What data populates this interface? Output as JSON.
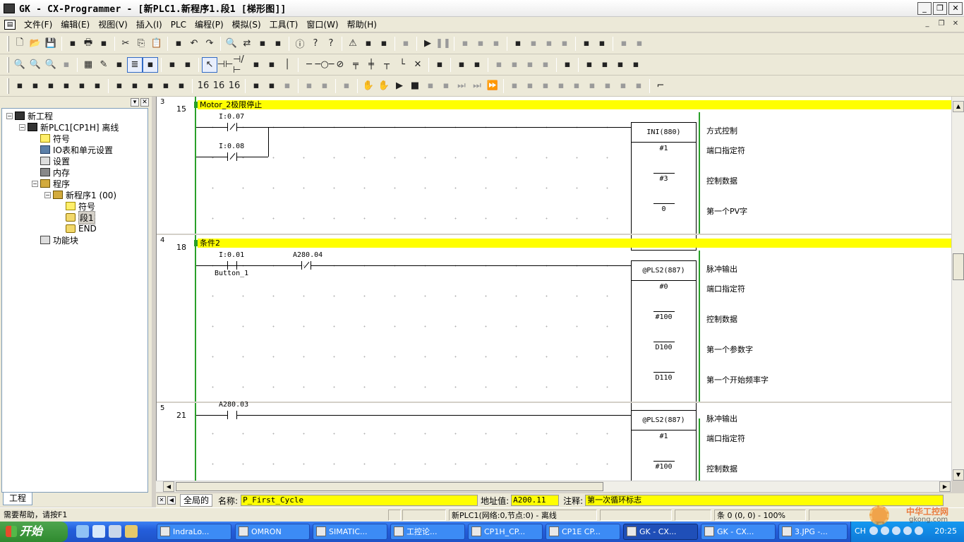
{
  "window": {
    "title": "GK - CX-Programmer - [新PLC1.新程序1.段1 [梯形图]]",
    "buttons": [
      "_",
      "❐",
      "✕"
    ]
  },
  "menu": {
    "items": [
      "文件(F)",
      "编辑(E)",
      "视图(V)",
      "插入(I)",
      "PLC",
      "编程(P)",
      "模拟(S)",
      "工具(T)",
      "窗口(W)",
      "帮助(H)"
    ],
    "mdi_buttons": [
      "_",
      "❐",
      "✕"
    ]
  },
  "toolbars": {
    "row1": [
      "new-icon",
      "open-icon",
      "save-icon",
      "sep",
      "print-preview-icon",
      "print-icon",
      "print-preview2-icon",
      "sep",
      "cut-icon",
      "copy-icon",
      "paste-icon",
      "sep",
      "paste-special-icon",
      "undo-icon",
      "redo-icon",
      "sep",
      "find-icon",
      "replace-icon",
      "replace-all-icon",
      "address-ref-icon",
      "sep",
      "properties-icon",
      "help-icon",
      "context-help-icon",
      "sep",
      "warning-icon",
      "compile-icon",
      "compile-all-icon",
      "sep",
      "online-toggle-icon",
      "sep",
      "play-icon",
      "pause-icon",
      "sep",
      "transfer-to-plc-icon",
      "transfer-from-plc-icon",
      "compare-icon",
      "sep",
      "monitor-icon",
      "monitor2-icon",
      "monitor3-icon",
      "monitor4-icon",
      "sep",
      "data-trace-icon",
      "time-chart-icon",
      "sep",
      "force-on-icon",
      "force-off-icon"
    ],
    "row2": [
      "zoom-out-small-icon",
      "zoom-in-icon",
      "zoom-icon",
      "zoom-disabled-icon",
      "sep",
      "grid-icon",
      "comment-icon",
      "show-list-icon",
      "rung-icon",
      "show-address-icon",
      "sep",
      "monitor-bin-icon",
      "cross-reference-icon",
      "sep",
      "select-cursor-icon",
      "no-contact-icon",
      "nc-contact-icon",
      "no-or-icon",
      "nc-or-icon",
      "vertical-line-icon",
      "sep",
      "horizontal-line-icon",
      "coil-icon",
      "nc-coil-icon",
      "instruction-icon",
      "fb-icon",
      "line-connect-icon",
      "line-corner-icon",
      "delete-line-icon",
      "sep",
      "online-edit-icon",
      "sep",
      "edit-rungs-icon",
      "data-edit-icon",
      "sep",
      "diff-icon",
      "diff2-icon",
      "diff3-icon",
      "diff4-icon",
      "sep",
      "io-comments-icon",
      "sep",
      "disp-icon",
      "disp2-icon",
      "disp3-icon",
      "disp4-icon"
    ],
    "row3": [
      "window-project-icon",
      "window-output-icon",
      "window-watch-icon",
      "window-address-icon",
      "window-symbol-icon",
      "window-properties-icon",
      "sep",
      "cross-ref-icon",
      "symbol-table-icon",
      "program-icon",
      "io-table-icon",
      "settings-icon",
      "sep",
      "binary-16-icon",
      "binary-16b-icon",
      "binary-16c-icon",
      "sep",
      "upload-icon",
      "download-icon",
      "step-icon",
      "sep",
      "plc-list-icon",
      "plc-cycle-icon",
      "sep",
      "plc-info-icon",
      "sep",
      "hand-icon",
      "hand2-icon",
      "run-icon",
      "stop-icon",
      "pause-step-icon",
      "step-run-icon",
      "step-into-icon",
      "step-over-icon",
      "fast-forward-icon",
      "sep",
      "io-map-icon",
      "io-map2-icon",
      "sim1-icon",
      "sim2-icon",
      "sim3-icon",
      "sim4-icon",
      "sim5-icon",
      "sim6-icon",
      "sim7-icon",
      "sep",
      "end-icon"
    ]
  },
  "project_tree": {
    "header_buttons": [
      "▾",
      "✕"
    ],
    "nodes": [
      {
        "label": "新工程",
        "level": 0,
        "expander": "−",
        "icon": "project-icon",
        "type": "plc"
      },
      {
        "label": "新PLC1[CP1H] 离线",
        "level": 1,
        "expander": "−",
        "icon": "plc-icon",
        "type": "plc"
      },
      {
        "label": "符号",
        "level": 2,
        "expander": "",
        "icon": "symbols-icon",
        "type": "sym"
      },
      {
        "label": "IO表和单元设置",
        "level": 2,
        "expander": "",
        "icon": "io-table-icon",
        "type": "ic"
      },
      {
        "label": "设置",
        "level": 2,
        "expander": "",
        "icon": "settings-icon",
        "type": "fb"
      },
      {
        "label": "内存",
        "level": 2,
        "expander": "",
        "icon": "memory-icon",
        "type": "mem"
      },
      {
        "label": "程序",
        "level": 2,
        "expander": "−",
        "icon": "programs-icon",
        "type": "prog"
      },
      {
        "label": "新程序1 (00)",
        "level": 3,
        "expander": "−",
        "icon": "program-icon",
        "type": "prog"
      },
      {
        "label": "符号",
        "level": 4,
        "expander": "",
        "icon": "local-symbols-icon",
        "type": "sym"
      },
      {
        "label": "段1",
        "level": 4,
        "expander": "",
        "icon": "section-icon",
        "type": "sec",
        "selected": true
      },
      {
        "label": "END",
        "level": 4,
        "expander": "",
        "icon": "end-section-icon",
        "type": "sec"
      },
      {
        "label": "功能块",
        "level": 2,
        "expander": "",
        "icon": "function-block-icon",
        "type": "fb"
      }
    ],
    "tab_label": "工程"
  },
  "ladder": {
    "rungs": [
      {
        "rung": "3",
        "step": "15",
        "comment": "Motor_2极限停止",
        "contacts": [
          {
            "address": "I:0.07",
            "type": "nc",
            "symbol": ""
          },
          {
            "address": "I:0.08",
            "type": "nc",
            "symbol": ""
          }
        ],
        "instruction": "INI(880)",
        "operands": [
          {
            "value": "#1",
            "desc": "端口指定符"
          },
          {
            "value": "#3",
            "desc": "控制数据"
          },
          {
            "value": "0",
            "desc": "第一个PV字"
          }
        ],
        "instruction_desc": "方式控制"
      },
      {
        "rung": "4",
        "step": "18",
        "comment": "条件2",
        "contacts": [
          {
            "address": "I:0.01",
            "type": "no",
            "symbol": "Button_1"
          },
          {
            "address": "A280.04",
            "type": "nc",
            "symbol": ""
          }
        ],
        "instruction": "@PLS2(887)",
        "operands": [
          {
            "value": "#0",
            "desc": "端口指定符"
          },
          {
            "value": "#100",
            "desc": "控制数据"
          },
          {
            "value": "D100",
            "desc": "第一个参数字"
          },
          {
            "value": "D110",
            "desc": "第一个开始频率字"
          }
        ],
        "instruction_desc": "脉冲输出"
      },
      {
        "rung": "5",
        "step": "21",
        "comment": "",
        "contacts": [
          {
            "address": "A280.03",
            "type": "no",
            "symbol": ""
          }
        ],
        "instruction": "@PLS2(887)",
        "operands": [
          {
            "value": "#1",
            "desc": "端口指定符"
          },
          {
            "value": "#100",
            "desc": "控制数据"
          }
        ],
        "instruction_desc": "脉冲输出"
      }
    ]
  },
  "symbol_bar": {
    "scope_tab": "全局的",
    "name_label": "名称:",
    "name_value": "P_First_Cycle",
    "address_label": "地址值:",
    "address_value": "A200.11",
    "comment_label": "注释:",
    "comment_value": "第一次循环标志"
  },
  "status_bar": {
    "help": "需要帮助，请按F1",
    "connection": "新PLC1(网络:0,节点:0) - 离线",
    "position": "条 0 (0, 0)  - 100%"
  },
  "taskbar": {
    "start_label": "开始",
    "tasks": [
      {
        "label": "IndraLo...",
        "active": false
      },
      {
        "label": "OMRON",
        "active": false
      },
      {
        "label": "SIMATIC...",
        "active": false
      },
      {
        "label": "工控论...",
        "active": false
      },
      {
        "label": "CP1H_CP...",
        "active": false
      },
      {
        "label": "CP1E CP...",
        "active": false
      },
      {
        "label": "GK - CX...",
        "active": true
      },
      {
        "label": "GK - CX...",
        "active": false
      },
      {
        "label": "3.JPG -...",
        "active": false
      }
    ],
    "tray_lang": "CH",
    "clock": "20:25"
  },
  "watermark": {
    "line1": "中华工控网",
    "line2": "gkong.com"
  }
}
